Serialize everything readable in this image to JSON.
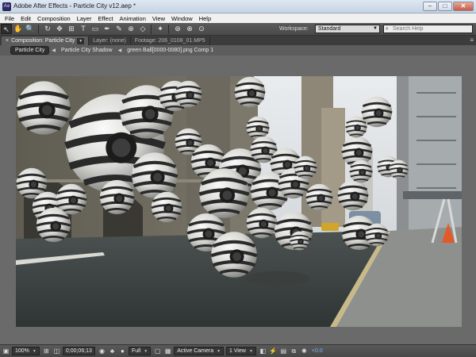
{
  "window": {
    "title": "Adobe After Effects - Particle City v12.aep *",
    "app_badge": "Ae",
    "minimize": "–",
    "maximize": "□",
    "close": "✕"
  },
  "menu": {
    "items": [
      "File",
      "Edit",
      "Composition",
      "Layer",
      "Effect",
      "Animation",
      "View",
      "Window",
      "Help"
    ]
  },
  "toolbar": {
    "tools": [
      {
        "name": "selection-tool",
        "glyph": "↖",
        "active": true
      },
      {
        "name": "hand-tool",
        "glyph": "✋"
      },
      {
        "name": "zoom-tool",
        "glyph": "🔍"
      },
      {
        "name": "rotation-tool",
        "glyph": "↻"
      },
      {
        "name": "camera-orbit-tool",
        "glyph": "✥"
      },
      {
        "name": "pan-behind-tool",
        "glyph": "⊞"
      },
      {
        "name": "text-tool",
        "glyph": "T"
      },
      {
        "name": "mask-tool",
        "glyph": "▭"
      },
      {
        "name": "pen-tool",
        "glyph": "✒"
      },
      {
        "name": "brush-tool",
        "glyph": "✎"
      },
      {
        "name": "clone-stamp-tool",
        "glyph": "⊕"
      },
      {
        "name": "eraser-tool",
        "glyph": "◇"
      },
      {
        "name": "puppet-pin-tool",
        "glyph": "✦"
      },
      {
        "name": "axis-mode-local",
        "glyph": "⊛"
      },
      {
        "name": "axis-mode-world",
        "glyph": "⊗"
      },
      {
        "name": "axis-mode-view",
        "glyph": "⊙"
      }
    ],
    "workspace_label": "Workspace:",
    "workspace_value": "Standard",
    "search_placeholder": "Search Help"
  },
  "panel_tabs": [
    {
      "label": "Composition: Particle City",
      "active": true
    },
    {
      "label": "Layer: (none)"
    },
    {
      "label": "Footage: 206_0108_01.MP5"
    }
  ],
  "breadcrumb": {
    "items": [
      "Particle City",
      "Particle City Shadow",
      "green Ball[0000-0080].png Comp 1"
    ]
  },
  "viewer_controls": {
    "zoom": "100%",
    "timecode": "0;00;06;13",
    "resolution": "Full",
    "camera": "Active Camera",
    "views": "1 View",
    "exposure": "+0.0"
  },
  "colors": {
    "panel": "#5d5d5d",
    "titlebar": "#c5d3e3",
    "accent_link": "#7fb3ff"
  }
}
